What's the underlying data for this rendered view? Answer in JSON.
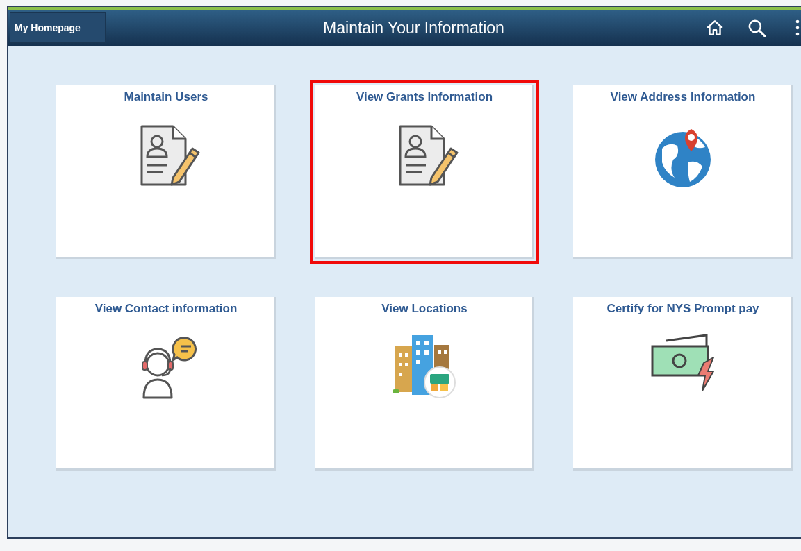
{
  "header": {
    "home_button": "My Homepage",
    "title": "Maintain Your Information"
  },
  "tiles": [
    {
      "title": "Maintain Users",
      "kind": "document",
      "highlighted": false
    },
    {
      "title": "View Grants Information",
      "kind": "document",
      "highlighted": true
    },
    {
      "title": "View Address Information",
      "kind": "globe",
      "highlighted": false
    },
    {
      "title": "View Contact information",
      "kind": "contact",
      "highlighted": false
    },
    {
      "title": "View Locations",
      "kind": "buildings",
      "highlighted": false
    },
    {
      "title": "Certify for NYS Prompt pay",
      "kind": "money",
      "highlighted": false
    }
  ]
}
